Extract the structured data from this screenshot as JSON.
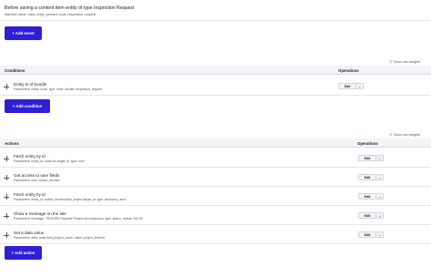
{
  "event": {
    "title": "Before saving a content item entity of type Inspection Request",
    "machine_name": "Machine name: rules_entity_presave:node--inspection_request",
    "add_event_label": "+ Add event"
  },
  "show_row_weights": "Show row weights",
  "conditions": {
    "header_conditions": "Conditions",
    "header_operations": "Operations",
    "rows": [
      {
        "title": "Entity is of bundle",
        "params": "Parameters: entity: node, type: node, bundle: inspection_request",
        "op": "Edit"
      }
    ],
    "add_label": "+ Add condition"
  },
  "actions": {
    "header_actions": "Actions",
    "header_operations": "Operations",
    "rows": [
      {
        "title": "Fetch entity by id",
        "params": "Parameters: entity_id: node.uid.target_id, type: user",
        "op": "Edit"
      },
      {
        "title": "Get access to user fields",
        "params": "Parameters: user: author_fetched",
        "op": "Edit"
      },
      {
        "title": "Fetch entity by id",
        "params": "Parameters: entity_id: author_fetched.field_project.target_id, type: taxonomy_term",
        "op": "Edit"
      },
      {
        "title": "Show a message on the site",
        "params": "Parameters: message: TRIGGER Populate Project and contractor, type: status, repeat: FALSE",
        "op": "Edit"
      },
      {
        "title": "Set a data value",
        "params": "Parameters: data: node.field_project_name, value: project_fetched",
        "op": "Edit"
      }
    ],
    "add_label": "+ Add action"
  },
  "icons": {
    "drag": "drag-handle-icon",
    "weights": "up-down-arrows-icon",
    "dropdown": "chevron-down-icon"
  },
  "colors": {
    "primary": "#2f1ed6",
    "header_bg": "#f3f4f9",
    "text": "#232429",
    "muted": "#55565b"
  }
}
